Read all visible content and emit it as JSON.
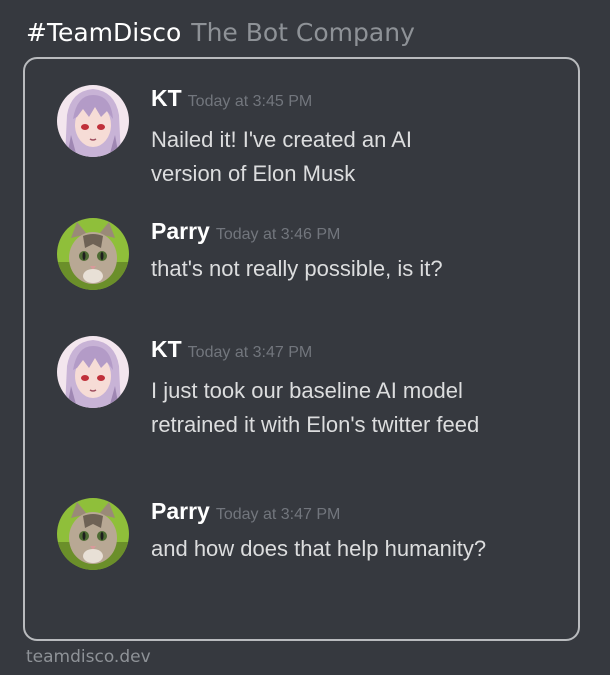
{
  "header": {
    "brand": "#TeamDisco",
    "subtitle": "The Bot Company"
  },
  "messages": [
    {
      "author": "KT",
      "timestamp": "Today at 3:45 PM",
      "lines": [
        "Nailed it!  I've created an AI",
        "version of Elon Musk"
      ],
      "avatar_icon": "anime-girl-avatar"
    },
    {
      "author": "Parry",
      "timestamp": "Today at 3:46 PM",
      "lines": [
        "that's not really possible, is it?"
      ],
      "avatar_icon": "cat-avatar"
    },
    {
      "author": "KT",
      "timestamp": "Today at 3:47 PM",
      "lines": [
        "I just took our baseline AI model",
        "retrained it with Elon's twitter feed"
      ],
      "avatar_icon": "anime-girl-avatar"
    },
    {
      "author": "Parry",
      "timestamp": "Today at 3:47 PM",
      "lines": [
        "and how does that help humanity?"
      ],
      "avatar_icon": "cat-avatar"
    }
  ],
  "footer": {
    "site": "teamdisco.dev"
  },
  "colors": {
    "background": "#36393f",
    "author": "#ffffff",
    "timestamp": "#72767d",
    "message_text": "#dcddde",
    "frame_border": "#b9bbbe"
  }
}
